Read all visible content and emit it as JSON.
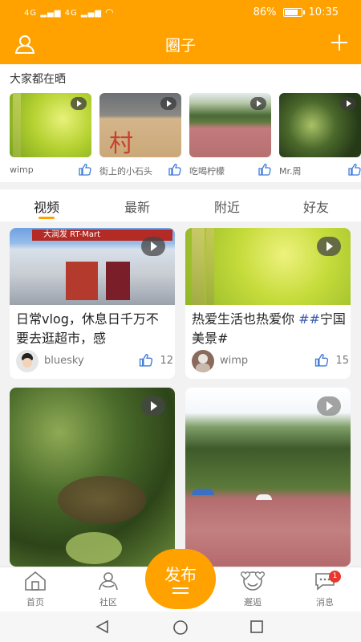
{
  "status_bar": {
    "signal_1": "4G",
    "signal_2": "4G",
    "battery": "86%",
    "battery_level": 0.86,
    "time": "10:35"
  },
  "header": {
    "title": "圈子"
  },
  "shares": {
    "title": "大家都在晒",
    "items": [
      {
        "name": "wimp"
      },
      {
        "name": "街上的小石头"
      },
      {
        "name": "吃喝柠檬"
      },
      {
        "name": "Mr.周"
      }
    ]
  },
  "tabs": [
    "视频",
    "最新",
    "附近",
    "好友"
  ],
  "cards": [
    {
      "caption": "日常vlog，休息日千万不要去逛超市，感",
      "author": "bluesky",
      "likes": "12",
      "media_text": "大润发 RT-Mart"
    },
    {
      "caption": "热爱生活也热爱你 ",
      "tag": "##",
      "caption2": "宁国美景#",
      "author": "wimp",
      "likes": "15"
    },
    {
      "caption": "",
      "author": "",
      "likes": ""
    },
    {
      "caption": "",
      "author": "",
      "likes": ""
    }
  ],
  "bottom_nav": {
    "home": "首页",
    "community": "社区",
    "publish": "发布",
    "encounter": "邂逅",
    "messages": "消息",
    "message_badge": "1"
  },
  "colors": {
    "accent": "#ffa200",
    "badge": "#e8372c"
  }
}
